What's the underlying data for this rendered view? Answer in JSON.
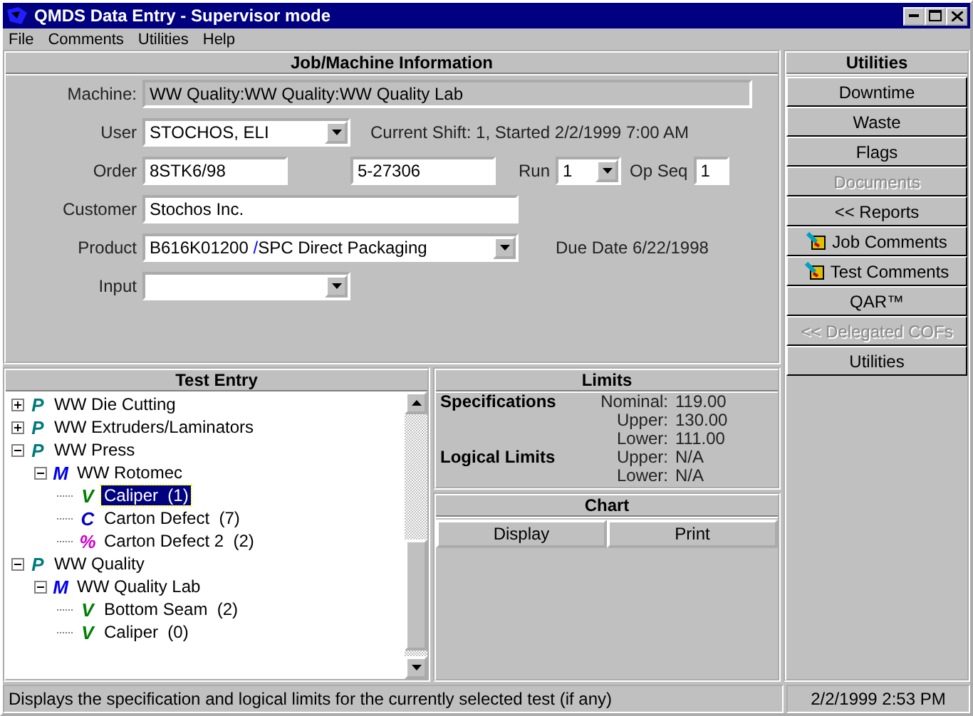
{
  "window": {
    "title": "QMDS Data Entry - Supervisor mode"
  },
  "menu": [
    {
      "label": "File"
    },
    {
      "label": "Comments"
    },
    {
      "label": "Utilities"
    },
    {
      "label": "Help"
    }
  ],
  "job": {
    "title": "Job/Machine Information",
    "machine": {
      "label": "Machine:",
      "value": "WW Quality:WW Quality:WW Quality Lab"
    },
    "user": {
      "label": "User",
      "value": "STOCHOS, ELI"
    },
    "shift_note": "Current Shift: 1, Started 2/2/1999 7:00 AM",
    "order": {
      "label": "Order",
      "value": "8STK6/98",
      "value_2": "5-27306"
    },
    "run": {
      "label": "Run",
      "value": "1"
    },
    "op_seq": {
      "label": "Op Seq",
      "value": "1"
    },
    "customer": {
      "label": "Customer",
      "value": "Stochos Inc."
    },
    "product": {
      "label": "Product",
      "code": "B616K01200",
      "separator": "/",
      "name": "SPC Direct Packaging"
    },
    "due_date": "Due Date 6/22/1998",
    "input": {
      "label": "Input"
    }
  },
  "utilities": {
    "title": "Utilities",
    "buttons": [
      {
        "label": "Downtime",
        "kind": "plain",
        "disabled": false
      },
      {
        "label": "Waste",
        "kind": "plain",
        "disabled": false
      },
      {
        "label": "Flags",
        "kind": "plain",
        "disabled": false
      },
      {
        "label": "Documents",
        "kind": "plain",
        "disabled": true
      },
      {
        "label": "<< Reports",
        "kind": "plain",
        "disabled": false
      },
      {
        "label": "Job Comments",
        "kind": "comment",
        "disabled": false
      },
      {
        "label": "Test Comments",
        "kind": "comment",
        "disabled": false
      },
      {
        "label": "QAR™",
        "kind": "plain",
        "disabled": false
      },
      {
        "label": "<< Delegated COFs",
        "kind": "plain",
        "disabled": true
      },
      {
        "label": "Utilities",
        "kind": "plain",
        "disabled": false
      }
    ]
  },
  "test_entry": {
    "title": "Test Entry",
    "tree": [
      {
        "glyph": "P",
        "kind": "plant",
        "label": "WW Die Cutting",
        "expanded": false,
        "selected": false
      },
      {
        "glyph": "P",
        "kind": "plant",
        "label": "WW Extruders/Laminators",
        "expanded": false,
        "selected": false
      },
      {
        "glyph": "P",
        "kind": "plant",
        "label": "WW Press",
        "expanded": true,
        "selected": false,
        "children": [
          {
            "glyph": "M",
            "kind": "machine",
            "label": "WW Rotomec",
            "expanded": true,
            "selected": false,
            "children": [
              {
                "glyph": "V",
                "kind": "variable",
                "label": "Caliper  (1)",
                "selected": true
              },
              {
                "glyph": "C",
                "kind": "count",
                "label": "Carton Defect  (7)",
                "selected": false
              },
              {
                "glyph": "%",
                "kind": "percent",
                "label": "Carton Defect 2  (2)",
                "selected": false
              }
            ]
          }
        ]
      },
      {
        "glyph": "P",
        "kind": "plant",
        "label": "WW Quality",
        "expanded": true,
        "selected": false,
        "children": [
          {
            "glyph": "M",
            "kind": "machine",
            "label": "WW Quality Lab",
            "expanded": true,
            "selected": false,
            "children": [
              {
                "glyph": "V",
                "kind": "variable",
                "label": "Bottom Seam  (2)",
                "selected": false
              },
              {
                "glyph": "V",
                "kind": "variable",
                "label": "Caliper  (0)",
                "selected": false
              }
            ]
          }
        ]
      }
    ]
  },
  "limits": {
    "title": "Limits",
    "groups": [
      {
        "name": "Specifications",
        "rows": [
          {
            "label": "Nominal:",
            "value": "119.00"
          },
          {
            "label": "Upper:",
            "value": "130.00"
          },
          {
            "label": "Lower:",
            "value": "111.00"
          }
        ]
      },
      {
        "name": "Logical Limits",
        "rows": [
          {
            "label": "Upper:",
            "value": "N/A"
          },
          {
            "label": "Lower:",
            "value": "N/A"
          }
        ]
      }
    ]
  },
  "chart": {
    "title": "Chart",
    "buttons": [
      {
        "label": "Display"
      },
      {
        "label": "Print"
      }
    ]
  },
  "status_bar": {
    "message": "Displays the specification and logical limits for the currently selected test (if any)",
    "time": "2/2/1999 2:53 PM"
  }
}
